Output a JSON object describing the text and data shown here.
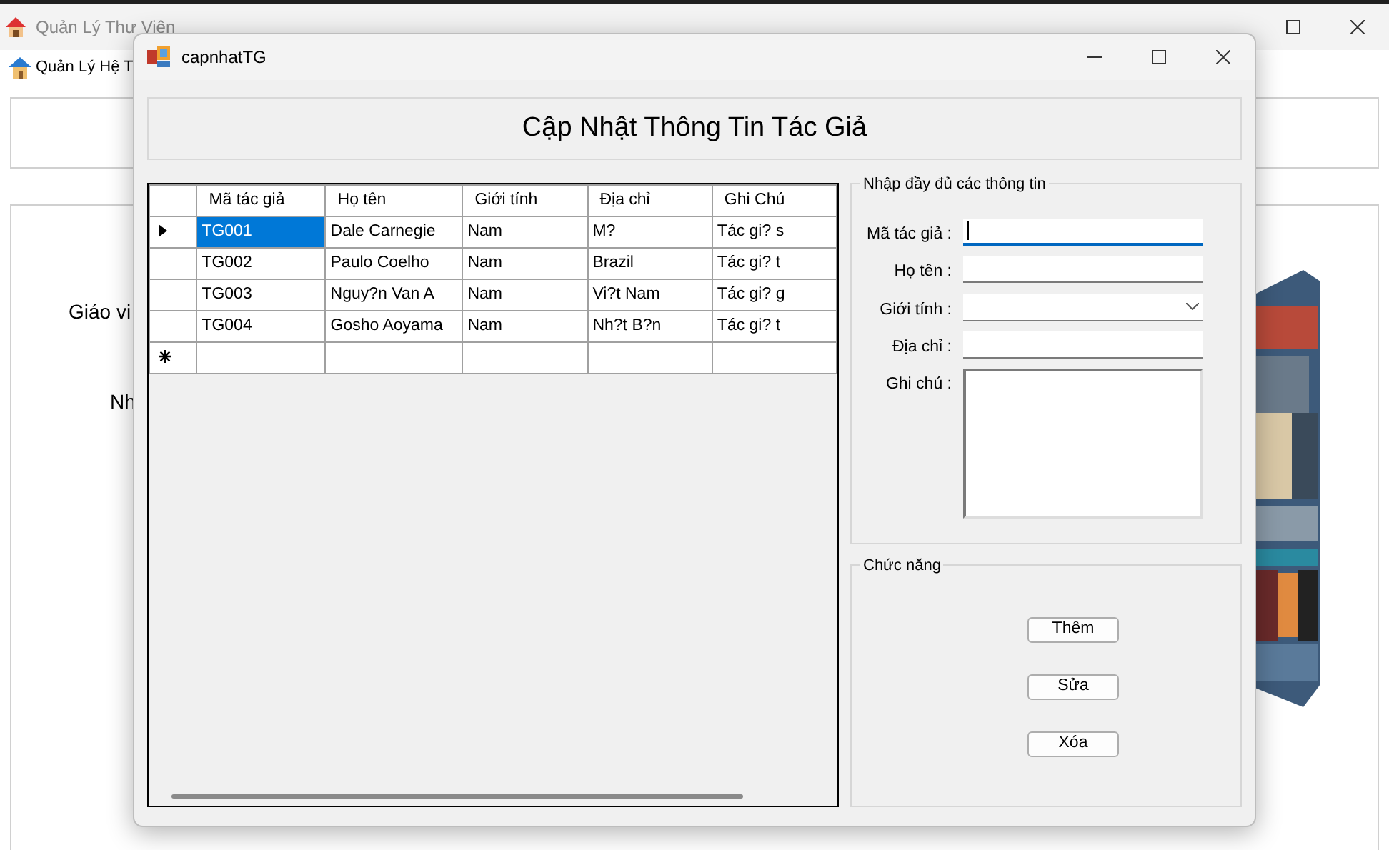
{
  "main_window": {
    "title": "Quản Lý Thư Viên",
    "menu": [
      {
        "label": "Quản Lý Hệ T"
      }
    ],
    "labels": [
      "Giáo vi",
      "Nh"
    ],
    "picture": {
      "kind": "picture"
    }
  },
  "dialog": {
    "title": "capnhatTG",
    "heading": "Cập Nhật Thông Tin Tác Giả",
    "grid": {
      "columns": [
        "Mã tác giả",
        "Họ tên",
        "Giới tính",
        "Địa chỉ",
        "Ghi Chú"
      ],
      "rows": [
        {
          "current": true,
          "cells": [
            {
              "text": "TG001",
              "selected": true
            },
            {
              "text": "Dale Carnegie",
              "selected": false
            },
            {
              "text": "Nam",
              "selected": false
            },
            {
              "text": "M?",
              "selected": false
            },
            {
              "text": "Tác gi? s",
              "selected": false
            }
          ]
        },
        {
          "current": false,
          "cells": [
            {
              "text": "TG002",
              "selected": false
            },
            {
              "text": "Paulo Coelho",
              "selected": false
            },
            {
              "text": "Nam",
              "selected": false
            },
            {
              "text": "Brazil",
              "selected": false
            },
            {
              "text": "Tác gi? t",
              "selected": false
            }
          ]
        },
        {
          "current": false,
          "cells": [
            {
              "text": "TG003",
              "selected": false
            },
            {
              "text": "Nguy?n Van A",
              "selected": false
            },
            {
              "text": "Nam",
              "selected": false
            },
            {
              "text": "Vi?t Nam",
              "selected": false
            },
            {
              "text": "Tác gi? g",
              "selected": false
            }
          ]
        },
        {
          "current": false,
          "cells": [
            {
              "text": "TG004",
              "selected": false
            },
            {
              "text": "Gosho Aoyama",
              "selected": false
            },
            {
              "text": "Nam",
              "selected": false
            },
            {
              "text": "Nh?t B?n",
              "selected": false
            },
            {
              "text": "Tác gi? t",
              "selected": false
            }
          ]
        }
      ]
    },
    "info_group": {
      "title": "Nhập đầy đủ các thông tin",
      "fields": [
        {
          "label": "Mã tác giả :",
          "kind": "text",
          "focused": true
        },
        {
          "label": "Họ tên :",
          "kind": "text",
          "focused": false
        },
        {
          "label": "Giới tính :",
          "kind": "combo",
          "focused": false
        },
        {
          "label": "Địa chỉ :",
          "kind": "text",
          "focused": false
        },
        {
          "label": "Ghi chú :",
          "kind": "textarea",
          "focused": false
        }
      ]
    },
    "function_group": {
      "title": "Chức năng",
      "buttons": [
        "Thêm",
        "Sửa",
        "Xóa"
      ]
    }
  }
}
